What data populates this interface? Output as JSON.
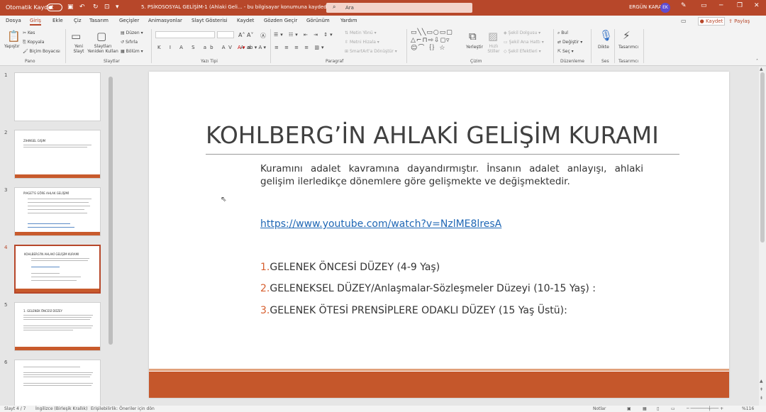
{
  "titlebar": {
    "autosave": "Otomatik Kaydet",
    "doc_title": "5. PSİKOSOSYAL GELİŞİM-1 (Ahlaki Geli... - bu bilgisayar konumuna kaydedildi",
    "search_placeholder": "Ara",
    "user": "ERGÜN KARA",
    "avatar": "EK"
  },
  "menu": {
    "tabs": [
      "Dosya",
      "Giriş",
      "Ekle",
      "Çiz",
      "Tasarım",
      "Geçişler",
      "Animasyonlar",
      "Slayt Gösterisi",
      "Kaydet",
      "Gözden Geçir",
      "Görünüm",
      "Yardım"
    ],
    "active": "Giriş",
    "save": "Kaydet",
    "share": "Paylaş"
  },
  "ribbon": {
    "clipboard": {
      "paste": "Yapıştır",
      "cut": "Kes",
      "copy": "Kopyala",
      "format": "Biçim Boyacısı",
      "label": "Pano"
    },
    "slides": {
      "new": "Yeni Slayt",
      "reuse": "Slaytları Yeniden Kullan",
      "layout": "Düzen",
      "reset": "Sıfırla",
      "section": "Bölüm",
      "label": "Slaytlar"
    },
    "font": {
      "label": "Yazı Tipi"
    },
    "paragraph": {
      "text_dir": "Metin Yönü",
      "align": "Metni Hizala",
      "smartart": "SmartArt'a Dönüştür",
      "label": "Paragraf"
    },
    "drawing": {
      "arrange": "Yerleştir",
      "quick_styles": "Hızlı Stiller",
      "fill": "Şekil Dolgusu",
      "outline": "Şekil Ana Hattı",
      "effects": "Şekil Efektleri",
      "label": "Çizim"
    },
    "editing": {
      "find": "Bul",
      "replace": "Değiştir",
      "select": "Seç",
      "label": "Düzenleme"
    },
    "voice": {
      "dictate": "Dikte",
      "label": "Ses"
    },
    "designer": {
      "designer": "Tasarımcı",
      "label": "Tasarımcı"
    }
  },
  "thumbs": {
    "n1": "1",
    "n2": "2",
    "n3": "3",
    "n4": "4",
    "n5": "5",
    "n6": "6",
    "t2": "ZIHINSEL GIŞIM",
    "t3": "PIAGET'E GÖRE AHLAK GELİŞİMİ",
    "t4": "KOHLBERG'İN AHLAKİ GELİŞİM KURAMI",
    "t5": "1. GELENEK ÖNCESİ DÜZEY"
  },
  "slide": {
    "title": "KOHLBERG’İN AHLAKİ GELİŞİM KURAMI",
    "body": "Kuramını adalet kavramına dayandırmıştır. İnsanın adalet anlayışı, ahlaki gelişim ilerledikçe dönemlere göre gelişmekte ve değişmektedir.",
    "link": "https://www.youtube.com/watch?v=NzlME8lresA",
    "items": [
      {
        "num": "1.",
        "text": "GELENEK ÖNCESİ DÜZEY (4-9 Yaş)"
      },
      {
        "num": "2.",
        "text": "GELENEKSEL DÜZEY/Anlaşmalar-Sözleşmeler Düzeyi (10-15 Yaş) :"
      },
      {
        "num": "3.",
        "text": "GELENEK ÖTESİ PRENSİPLERE ODAKLI DÜZEY (15 Yaş Üstü):"
      }
    ]
  },
  "status": {
    "slide": "Slayt 4 / 7",
    "lang": "İngilizce (Birleşik Krallık)",
    "access": "Erişilebilirlik: Öneriler için dön",
    "notes": "Notlar",
    "zoom": "%116"
  },
  "colors": {
    "accent": "#b7472a",
    "band": "#c5572b",
    "number": "#d75f2f",
    "link": "#1f67b5"
  }
}
